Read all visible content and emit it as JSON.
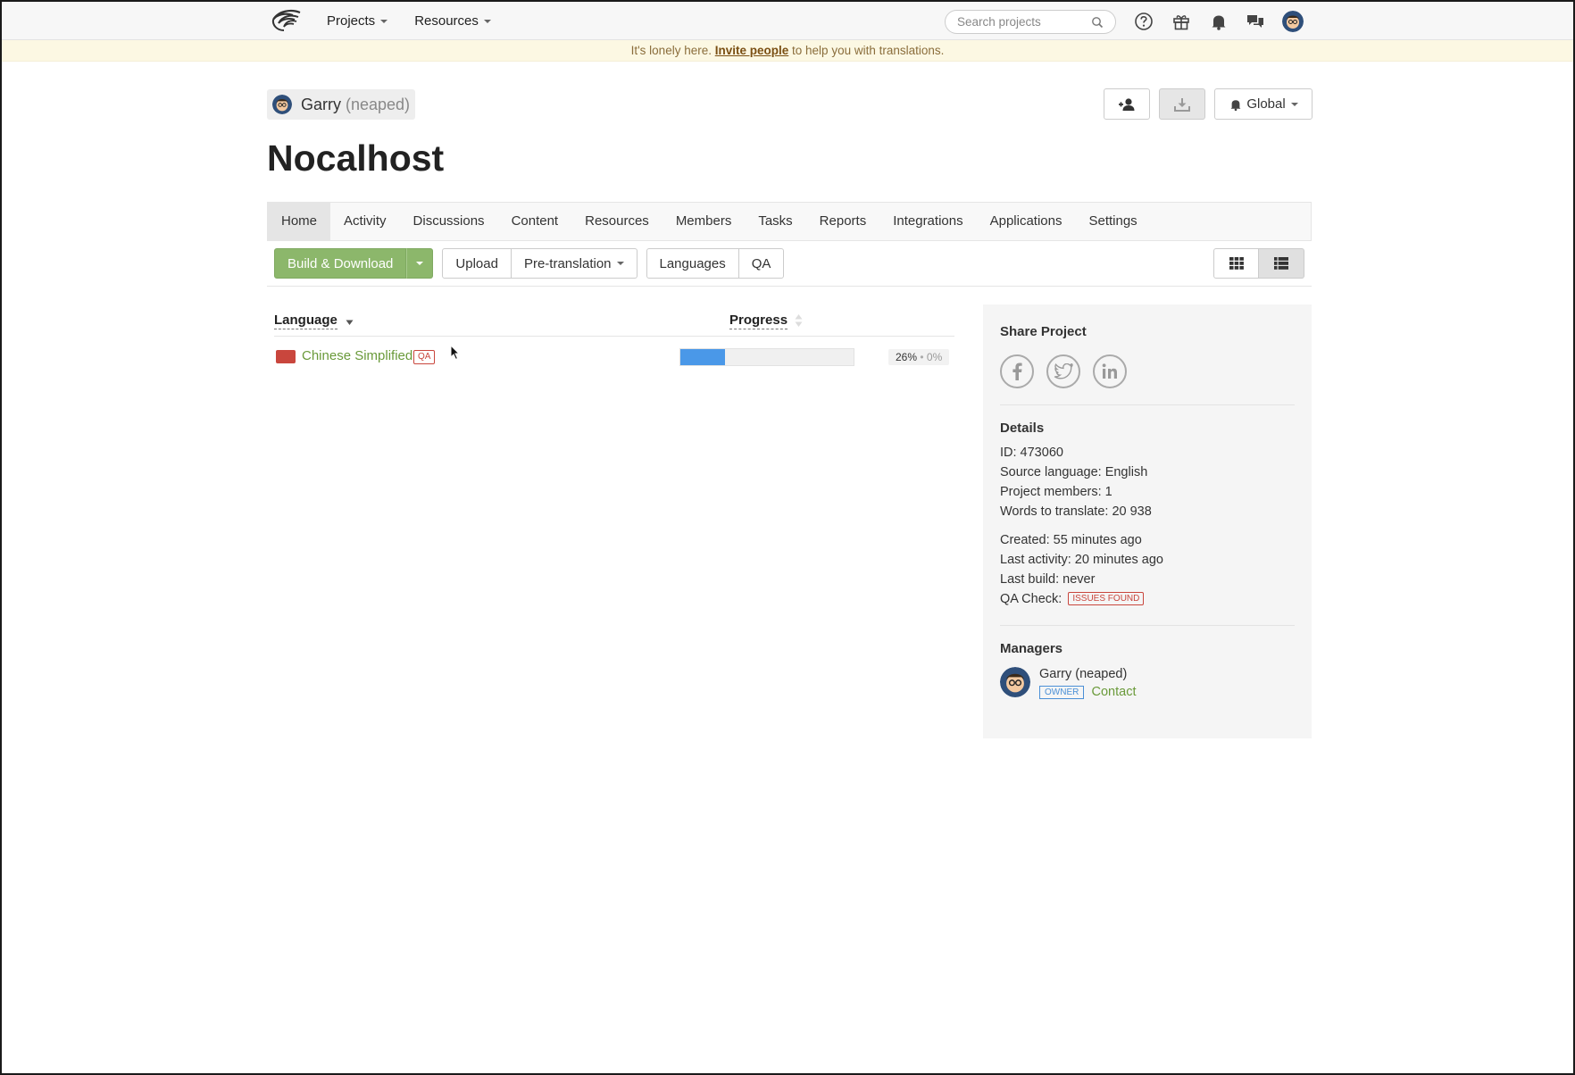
{
  "topbar": {
    "logo": "crowdin-logo",
    "menu": [
      {
        "label": "Projects"
      },
      {
        "label": "Resources"
      }
    ],
    "search": {
      "placeholder": "Search projects",
      "value": ""
    },
    "icons": [
      "help-icon",
      "gift-icon",
      "bell-icon",
      "chat-icon",
      "avatar"
    ]
  },
  "banner": {
    "prefix": "It's lonely here.",
    "link": "Invite people",
    "suffix": "to help you with translations."
  },
  "project": {
    "owner_name": "Garry",
    "owner_handle": "(neaped)",
    "title": "Nocalhost",
    "notifications_label": "Global"
  },
  "tabs": [
    {
      "label": "Home",
      "active": true
    },
    {
      "label": "Activity"
    },
    {
      "label": "Discussions"
    },
    {
      "label": "Content"
    },
    {
      "label": "Resources"
    },
    {
      "label": "Members"
    },
    {
      "label": "Tasks"
    },
    {
      "label": "Reports"
    },
    {
      "label": "Integrations"
    },
    {
      "label": "Applications"
    },
    {
      "label": "Settings"
    }
  ],
  "toolbar": {
    "build_download": "Build & Download",
    "upload": "Upload",
    "pretranslation": "Pre-translation",
    "languages": "Languages",
    "qa": "QA"
  },
  "table": {
    "col_language": "Language",
    "col_progress": "Progress",
    "rows": [
      {
        "language": "Chinese Simplified",
        "badge": "QA",
        "translated_pct": 26,
        "translated_label": "26%",
        "separator": "•",
        "approved_label": "0%",
        "flag_color": "#c9463d"
      }
    ]
  },
  "sidebar": {
    "share_title": "Share Project",
    "share_icons": [
      "facebook-icon",
      "twitter-icon",
      "linkedin-icon"
    ],
    "details_title": "Details",
    "id": "ID: 473060",
    "source_language": "Source language: English",
    "members": "Project members: 1",
    "words": "Words to translate: 20 938",
    "created": "Created: 55 minutes ago",
    "last_activity": "Last activity: 20 minutes ago",
    "last_build": "Last build: never",
    "qa_check_label": "QA Check:",
    "qa_check_badge": "ISSUES FOUND",
    "managers_title": "Managers",
    "manager_name": "Garry (neaped)",
    "manager_role": "OWNER",
    "manager_contact": "Contact"
  },
  "colors": {
    "accent_green": "#8cb76b",
    "progress_blue": "#4a98e8",
    "link_green": "#6a9a3a",
    "warning_red": "#c9463d"
  }
}
